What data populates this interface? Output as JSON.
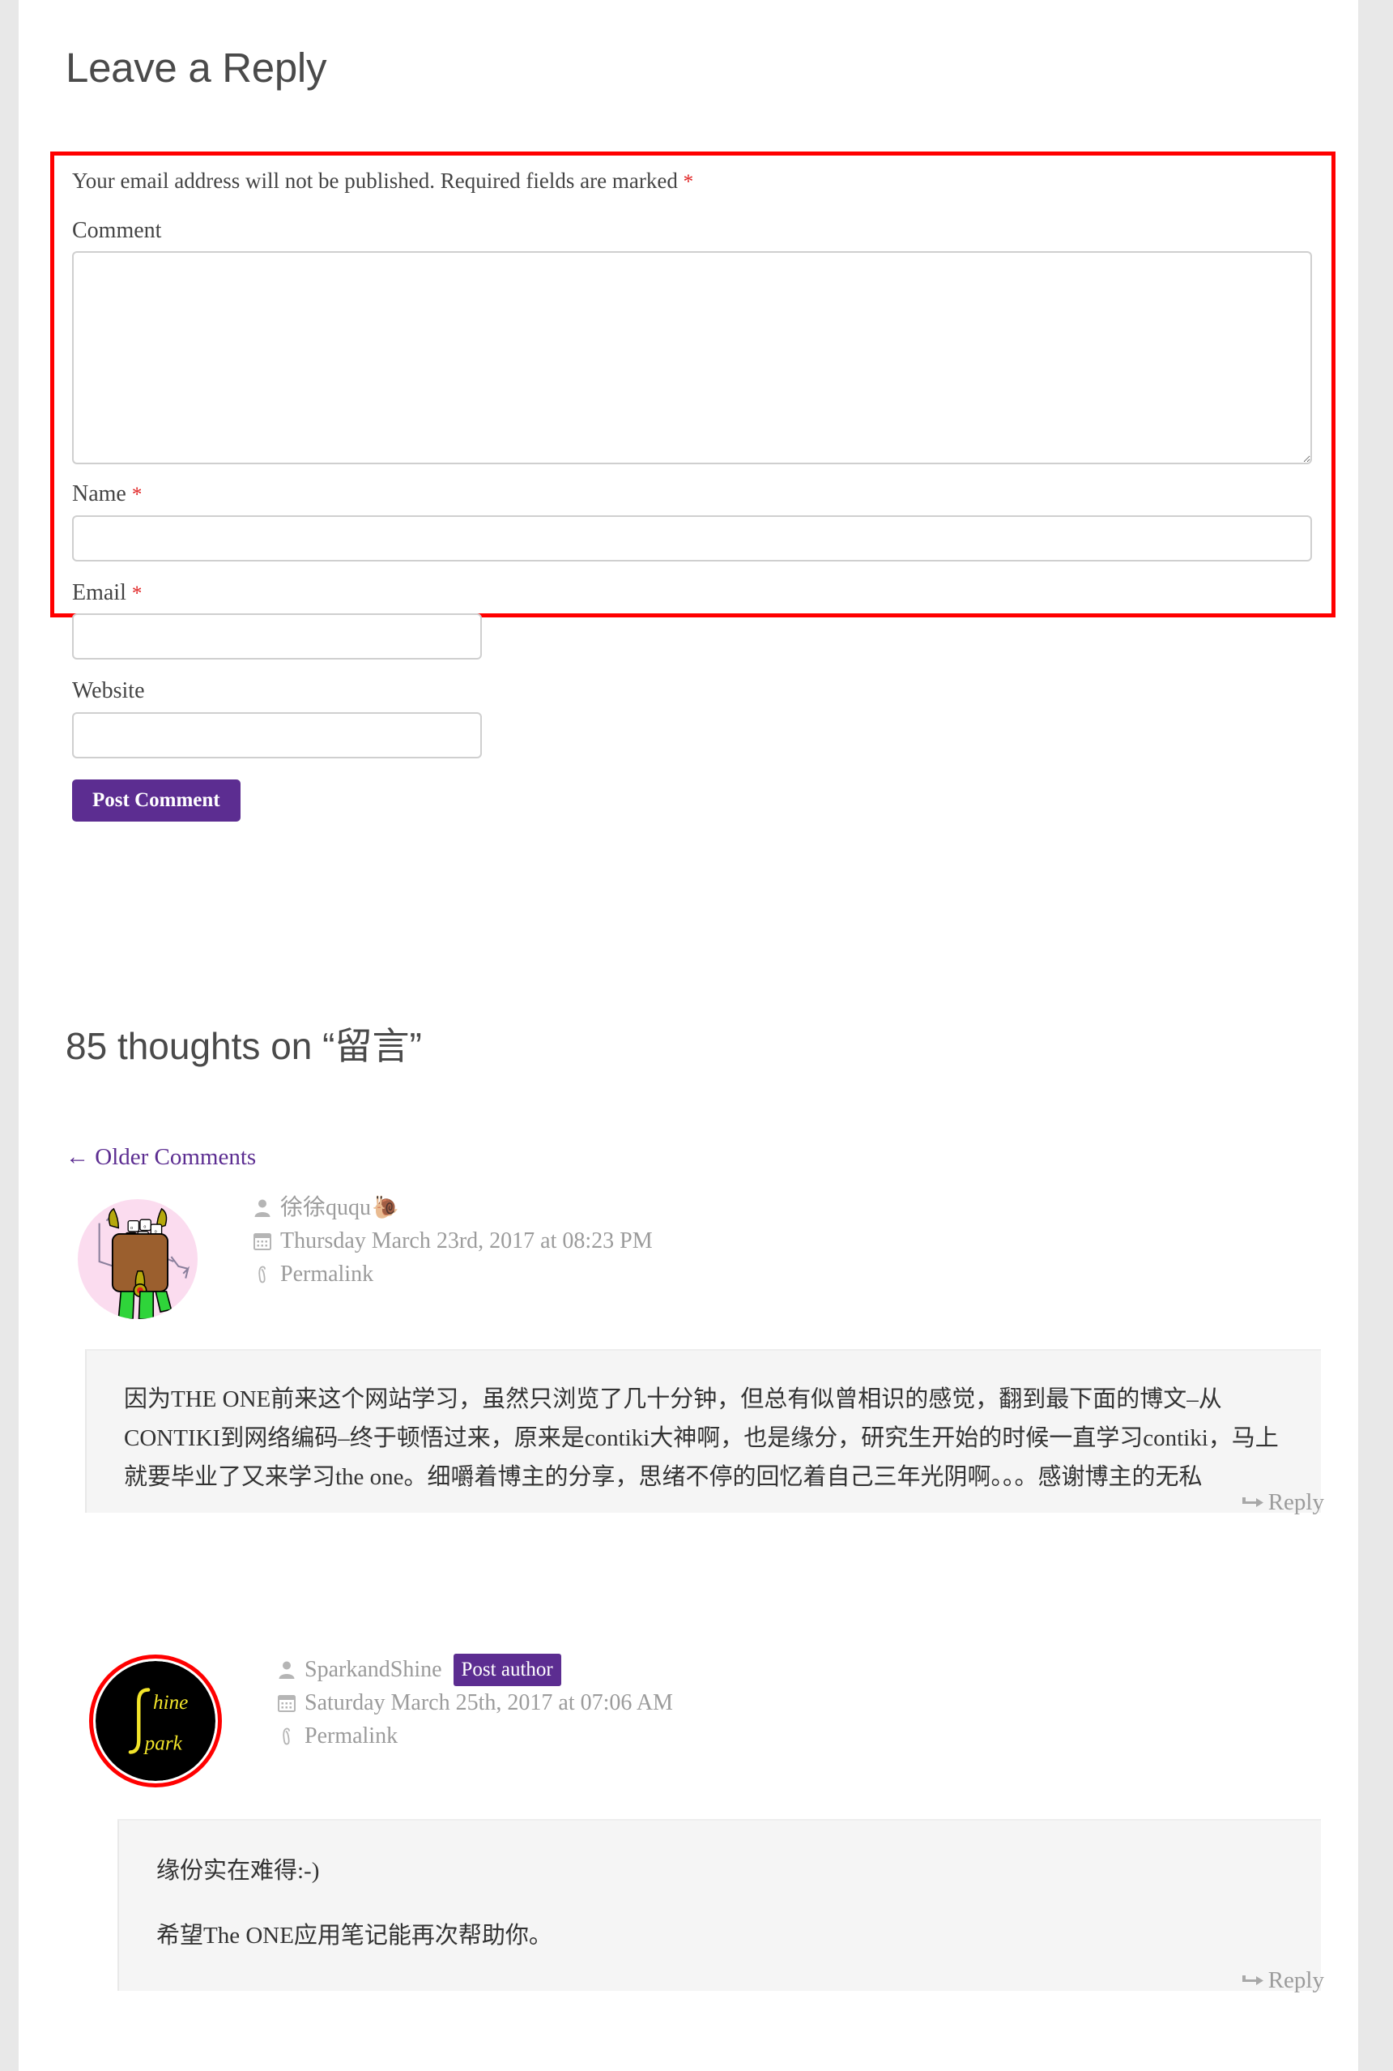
{
  "page": {
    "reply_heading": "Leave a Reply",
    "background_color": "#e8e8e8",
    "accent_color": "#5c2d91",
    "highlight_color": "#ff0000"
  },
  "form": {
    "notice_text": "Your email address will not be published. Required fields are marked",
    "required_marker": "*",
    "comment_label": "Comment",
    "comment_value": "",
    "comment_placeholder": "",
    "name_label": "Name",
    "name_required_marker": "*",
    "name_value": "",
    "name_placeholder": "",
    "email_label": "Email",
    "email_required_marker": "*",
    "email_value": "",
    "email_placeholder": "",
    "website_label": "Website",
    "website_value": "",
    "website_placeholder": "",
    "submit_label": "Post Comment"
  },
  "discussion": {
    "heading": "85 thoughts on “留言”",
    "count": 85,
    "post_title": "留言",
    "older_comments_label": "← Older Comments"
  },
  "comments": [
    {
      "author": "徐徐ququ",
      "author_emoji": "🐌",
      "is_post_author": false,
      "post_author_badge": "",
      "date": "Thursday March 23rd, 2017 at 08:23 PM",
      "permalink_label": "Permalink",
      "reply_label": "Reply",
      "paragraphs": [
        "因为THE ONE前来这个网站学习，虽然只浏览了几十分钟，但总有似曾相识的感觉，翻到最下面的博文–从CONTIKI到网络编码–终于顿悟过来，原来是contiki大神啊，也是缘分，研究生开始的时候一直学习contiki，马上就要毕业了又来学习the one。细嚼着博主的分享，思绪不停的回忆着自己三年光阴啊。。。感谢博主的无私"
      ]
    },
    {
      "author": "SparkandShine",
      "author_emoji": "",
      "is_post_author": true,
      "post_author_badge": "Post author",
      "date": "Saturday March 25th, 2017 at 07:06 AM",
      "permalink_label": "Permalink",
      "reply_label": "Reply",
      "avatar_text_top": "hine",
      "avatar_text_bottom": "park",
      "paragraphs": [
        "缘份实在难得:-)",
        "希望The ONE应用笔记能再次帮助你。"
      ]
    }
  ],
  "icons": {
    "user": "user-icon",
    "calendar": "calendar-icon",
    "link": "link-icon",
    "reply_arrow": "reply-arrow-icon"
  }
}
